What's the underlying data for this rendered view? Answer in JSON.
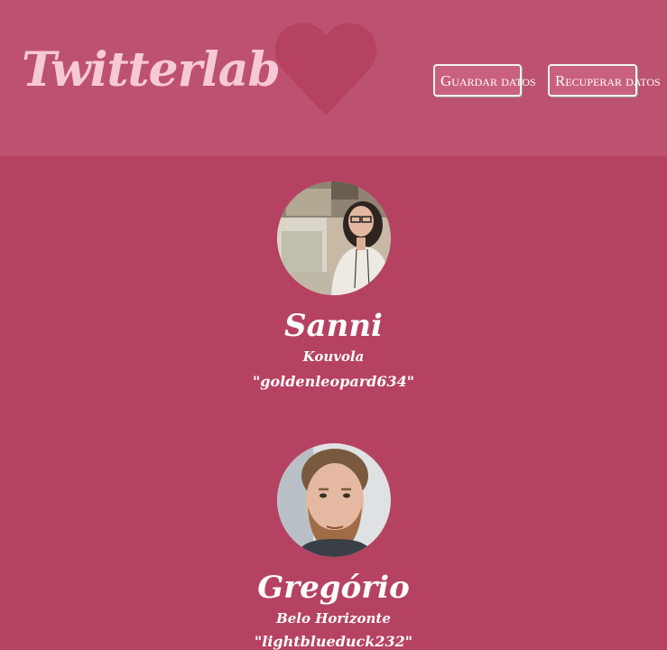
{
  "header": {
    "title": "Twitterlab",
    "save_label": "Guardar datos",
    "load_label": "Recuperar datos"
  },
  "colors": {
    "background": "#b64262",
    "header_background": "#bd5270",
    "logo": "#f7c9d6",
    "heart": "#b64262",
    "button_fill": "#c9607e",
    "button_border": "#f3f3f3",
    "text": "#ffffff"
  },
  "profiles": [
    {
      "name": "Sanni",
      "city": "Kouvola",
      "handle": "\"goldenleopard634\"",
      "avatar_icon": "woman-at-computer-photo"
    },
    {
      "name": "Gregório",
      "city": "Belo Horizonte",
      "handle": "\"lightblueduck232\"",
      "avatar_icon": "bearded-man-portrait-photo"
    }
  ]
}
